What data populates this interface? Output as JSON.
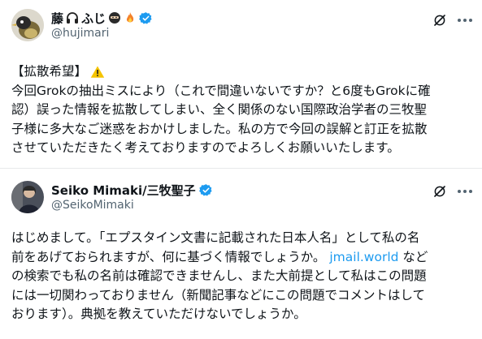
{
  "post1": {
    "display_name": "藤",
    "name_decor_icons": [
      "headphones-icon",
      "ninja-icon",
      "fire-icon"
    ],
    "name_suffix": "ふじ",
    "handle": "@hujimari",
    "verified": true,
    "body_lines": [
      "【拡散希望】",
      "今回Grokの抽出ミスにより（これで間違いないですか？と6度もGrokに確",
      "認）誤った情報を拡散してしまい、全く関係のない国際政治学者の三牧聖",
      "子様に多大なご迷惑をおかけしました。私の方で今回の誤解と訂正を拡散",
      "させていただきたく考えておりますのでよろしくお願いいたします。"
    ],
    "warning_icon": "warning-icon"
  },
  "post2": {
    "display_name": "Seiko Mimaki/三牧聖子",
    "handle": "@SeikoMimaki",
    "verified": true,
    "body_lines": [
      "はじめまして。「エプスタイン文書に記載された日本人名」として私の名",
      "前をあげておられますが、何に基づく情報でしょうか。",
      "の検索でも私の名前は確認できませんし、また大前提として私はこの問題",
      "には一切関わっておりません（新聞記事などにこの問題でコメントはして",
      "おります）。典拠を教えていただけないでしょうか。"
    ],
    "link_text": "jmail.world",
    "line2_tail": "など"
  },
  "colors": {
    "verified": "#1d9bf0",
    "link": "#1d9bf0",
    "muted": "#536471"
  }
}
